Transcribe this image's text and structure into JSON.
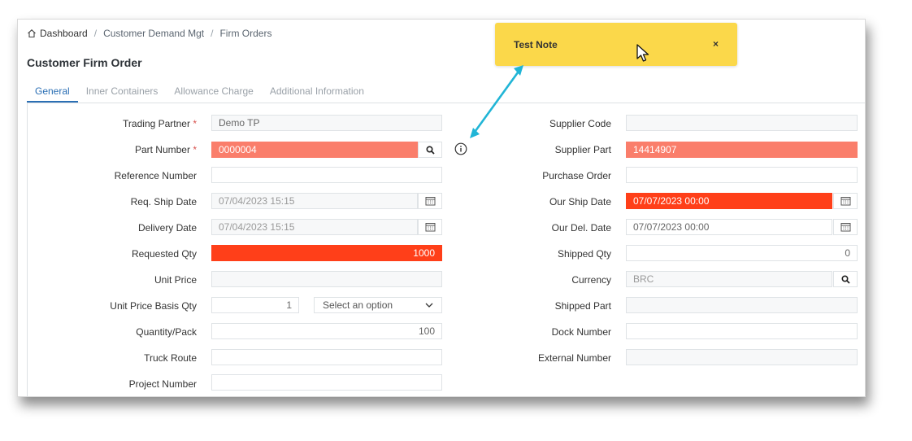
{
  "breadcrumb": {
    "home": "Dashboard",
    "level2": "Customer Demand Mgt",
    "level3": "Firm Orders"
  },
  "page_title": "Customer Firm Order",
  "tabs": [
    "General",
    "Inner Containers",
    "Allowance Charge",
    "Additional Information"
  ],
  "note": {
    "text": "Test Note",
    "close": "×"
  },
  "left_fields": {
    "trading_partner": {
      "label": "Trading Partner",
      "value": "Demo TP"
    },
    "part_number": {
      "label": "Part Number",
      "value": "0000004"
    },
    "reference_number": {
      "label": "Reference Number",
      "value": ""
    },
    "req_ship_date": {
      "label": "Req. Ship Date",
      "value": "07/04/2023 15:15"
    },
    "delivery_date": {
      "label": "Delivery Date",
      "value": "07/04/2023 15:15"
    },
    "requested_qty": {
      "label": "Requested Qty",
      "value": "1000"
    },
    "unit_price": {
      "label": "Unit Price",
      "value": ""
    },
    "unit_price_basis_qty": {
      "label": "Unit Price Basis Qty",
      "value": "1",
      "select": "Select an option"
    },
    "quantity_pack": {
      "label": "Quantity/Pack",
      "value": "100"
    },
    "truck_route": {
      "label": "Truck Route",
      "value": ""
    },
    "project_number": {
      "label": "Project Number",
      "value": ""
    }
  },
  "right_fields": {
    "supplier_code": {
      "label": "Supplier Code",
      "value": ""
    },
    "supplier_part": {
      "label": "Supplier Part",
      "value": "14414907"
    },
    "purchase_order": {
      "label": "Purchase Order",
      "value": ""
    },
    "our_ship_date": {
      "label": "Our Ship Date",
      "value": "07/07/2023 00:00"
    },
    "our_del_date": {
      "label": "Our Del. Date",
      "value": "07/07/2023 00:00"
    },
    "shipped_qty": {
      "label": "Shipped Qty",
      "value": "0"
    },
    "currency": {
      "label": "Currency",
      "value": "BRC"
    },
    "shipped_part": {
      "label": "Shipped Part",
      "value": ""
    },
    "dock_number": {
      "label": "Dock Number",
      "value": ""
    },
    "external_number": {
      "label": "External Number",
      "value": ""
    }
  },
  "required_mark": "*",
  "icons": [
    "home-icon",
    "search-icon",
    "calendar-icon",
    "chevron-down-icon",
    "info-icon",
    "cursor-icon"
  ],
  "colors": {
    "error_field": "#fa7e6b",
    "hot_field": "#ff3f19",
    "note_bg": "#fbd84a",
    "accent": "#2b6fb4",
    "arrow": "#21b5d6"
  }
}
